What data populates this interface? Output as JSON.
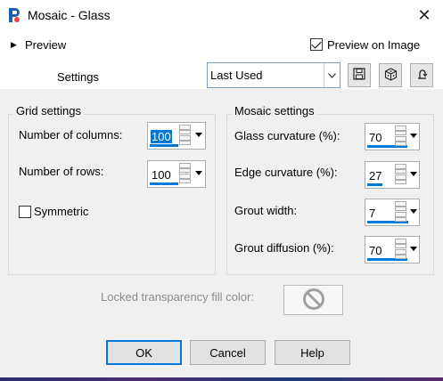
{
  "window": {
    "title": "Mosaic - Glass",
    "close_glyph": "✕"
  },
  "preview": {
    "label": "Preview",
    "arrow_glyph": "▶",
    "preview_on_image_label": "Preview on Image",
    "preview_on_image_checked": true
  },
  "settings": {
    "label": "Settings",
    "selected_value": "Last Used"
  },
  "grid": {
    "title": "Grid settings",
    "columns": {
      "label": "Number of columns:",
      "value": "100"
    },
    "rows": {
      "label": "Number of rows:",
      "value": "100"
    },
    "symmetric": {
      "label": "Symmetric",
      "checked": false
    }
  },
  "mosaic": {
    "title": "Mosaic settings",
    "glass_curvature": {
      "label": "Glass curvature (%):",
      "value": "70"
    },
    "edge_curvature": {
      "label": "Edge curvature (%):",
      "value": "27"
    },
    "grout_width": {
      "label": "Grout width:",
      "value": "7"
    },
    "grout_diffusion": {
      "label": "Grout diffusion (%):",
      "value": "70"
    }
  },
  "locked": {
    "label": "Locked transparency fill color:"
  },
  "buttons": {
    "ok": "OK",
    "cancel": "Cancel",
    "help": "Help"
  },
  "colors": {
    "accent": "#0078d7",
    "dialog_bg": "#f0f0f0"
  },
  "icons": {
    "app": "psp-app-icon",
    "close": "close-icon",
    "preview_arrow": "chevron-right-icon",
    "save": "save-icon",
    "randomize": "dice-icon",
    "reset": "reset-icon",
    "locked": "prohibited-icon"
  }
}
